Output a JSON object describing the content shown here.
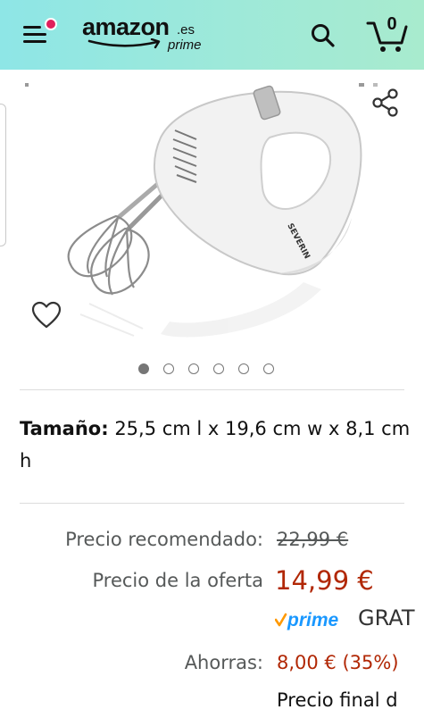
{
  "header": {
    "logo_text": "amazon",
    "logo_tld": ".es",
    "logo_prime": "prime",
    "cart_count": "0",
    "menu_icon": "hamburger-menu-icon",
    "search_icon": "search-icon",
    "cart_icon": "cart-icon"
  },
  "gallery": {
    "image_alt": "SEVERIN hand mixer",
    "brand_printed": "SEVERIN",
    "image_count": 6,
    "active_index": 0,
    "share_icon": "share-icon",
    "wishlist_icon": "heart-icon"
  },
  "size": {
    "label": "Tamaño:",
    "value": "25,5 cm l x 19,6 cm w x 8,1 cm h"
  },
  "pricing": {
    "recommended_label": "Precio recomendado:",
    "recommended_value": "22,99 €",
    "offer_label": "Precio de la oferta",
    "offer_value": "14,99 €",
    "prime_badge": "prime",
    "shipping_text": "GRAT",
    "savings_label": "Ahorras:",
    "savings_value": "8,00 € (35%)",
    "final_price_text": "Precio final d"
  },
  "colors": {
    "header_gradient_start": "#8ee6e6",
    "header_gradient_end": "#a8ebce",
    "price_red": "#b12704",
    "label_gray": "#565959",
    "prime_blue": "#1a98ff",
    "notification_dot": "#e01f5c"
  }
}
